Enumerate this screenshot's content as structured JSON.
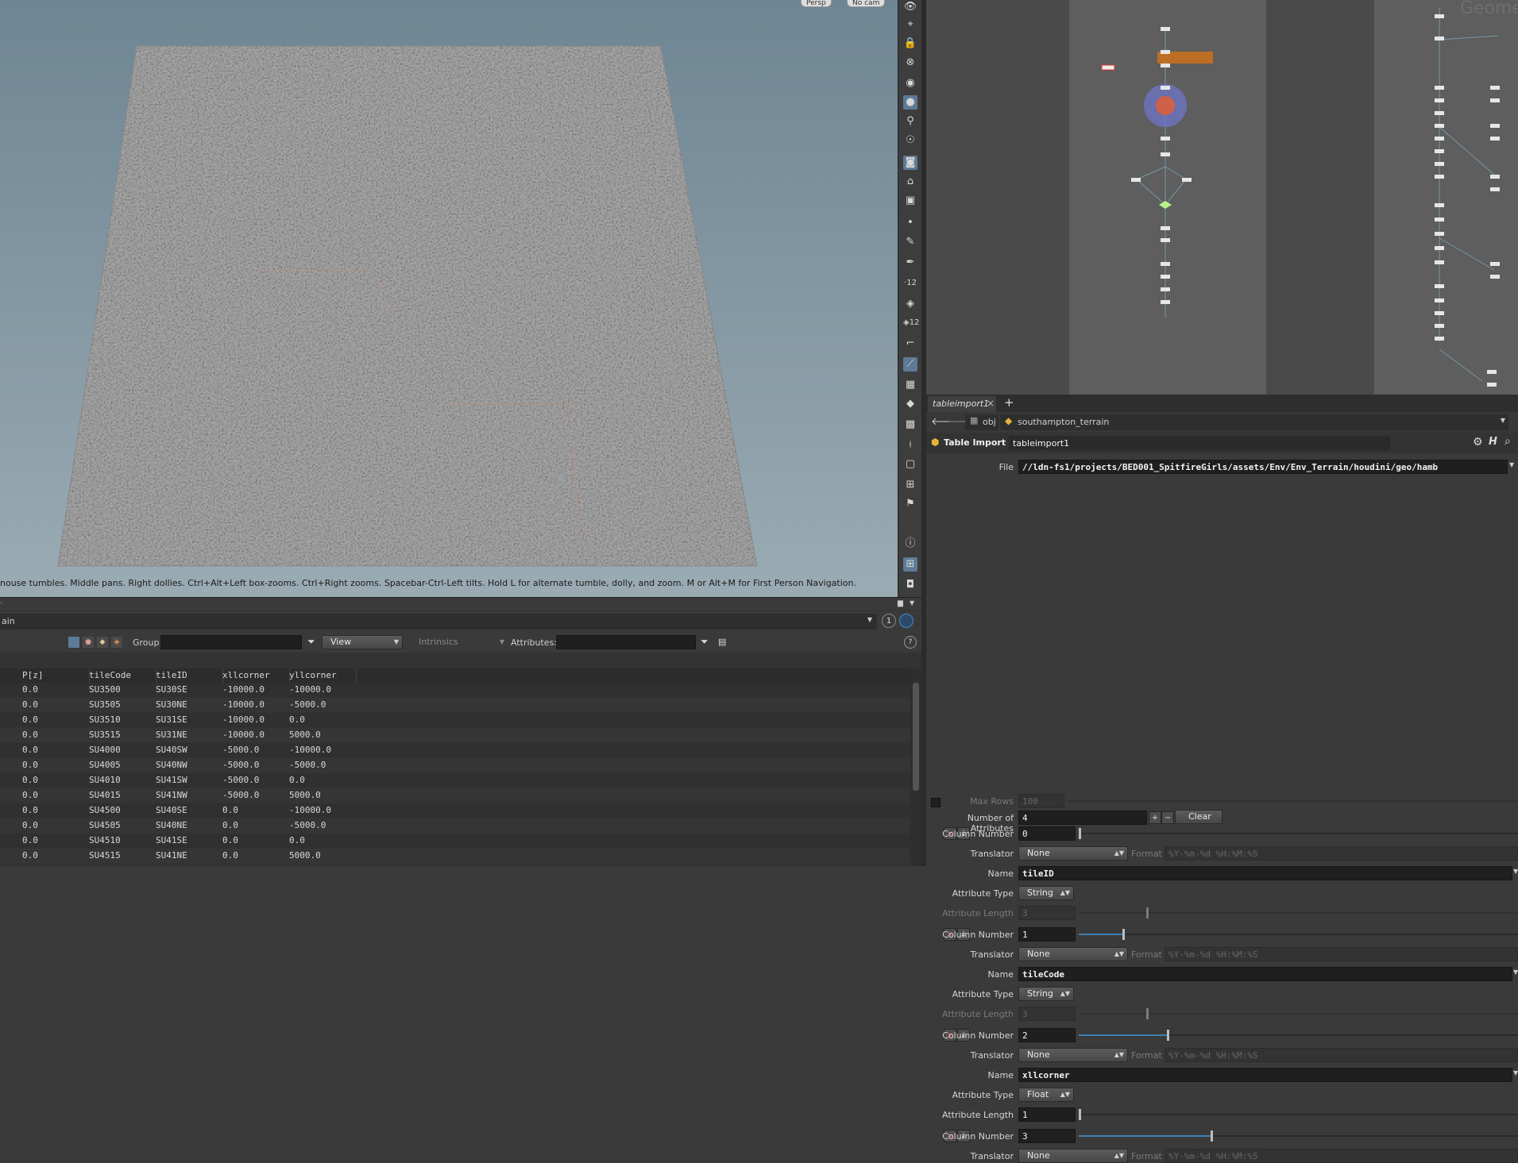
{
  "viewport": {
    "hint": "nouse tumbles. Middle pans. Right dollies. Ctrl+Alt+Left box-zooms. Ctrl+Right zooms. Spacebar-Ctrl-Left tilts. Hold L for alternate tumble, dolly, and zoom.     M or Alt+M for First Person Navigation.",
    "top_buttons": [
      "Persp",
      "No cam"
    ]
  },
  "network": {
    "watermark": "Geome"
  },
  "params": {
    "tab_label": "tableimport1",
    "path": {
      "root": "obj",
      "node": "southampton_terrain"
    },
    "node_type": "Table Import",
    "node_name": "tableimport1",
    "file_label": "File",
    "file_value": "//ldn-fs1/projects/BED001_SpitfireGirls/assets/Env/Env_Terrain/houdini/geo/hamb",
    "max_rows_label": "Max Rows",
    "max_rows_value": "100",
    "num_attr_label": "Number of Attributes",
    "num_attr_value": "4",
    "clear_label": "Clear",
    "labels": {
      "column": "Column Number",
      "translator": "Translator",
      "format": "Format",
      "name": "Name",
      "type": "Attribute Type",
      "length": "Attribute Length"
    },
    "format_placeholder": "%Y-%m-%d %H:%M:%S",
    "attributes": [
      {
        "column": "0",
        "translator": "None",
        "name": "tileID",
        "type": "String",
        "length": "3",
        "length_enabled": false,
        "slider": 0.0
      },
      {
        "column": "1",
        "translator": "None",
        "name": "tileCode",
        "type": "String",
        "length": "3",
        "length_enabled": false,
        "slider": 0.1
      },
      {
        "column": "2",
        "translator": "None",
        "name": "xllcorner",
        "type": "Float",
        "length": "1",
        "length_enabled": true,
        "slider": 0.2
      },
      {
        "column": "3",
        "translator": "None",
        "slider": 0.3
      }
    ]
  },
  "sheet": {
    "path": "ain",
    "group_label": "Group:",
    "view_label": "View",
    "intrinsics_label": "Intrinsics",
    "attributes_label": "Attributes:",
    "columns": [
      "P[z]",
      "tileCode",
      "tileID",
      "xllcorner",
      "yllcorner"
    ],
    "rows": [
      [
        "0.0",
        "SU3500",
        "SU30SE",
        "-10000.0",
        "-10000.0"
      ],
      [
        "0.0",
        "SU3505",
        "SU30NE",
        "-10000.0",
        "-5000.0"
      ],
      [
        "0.0",
        "SU3510",
        "SU31SE",
        "-10000.0",
        "0.0"
      ],
      [
        "0.0",
        "SU3515",
        "SU31NE",
        "-10000.0",
        "5000.0"
      ],
      [
        "0.0",
        "SU4000",
        "SU40SW",
        "-5000.0",
        "-10000.0"
      ],
      [
        "0.0",
        "SU4005",
        "SU40NW",
        "-5000.0",
        "-5000.0"
      ],
      [
        "0.0",
        "SU4010",
        "SU41SW",
        "-5000.0",
        "0.0"
      ],
      [
        "0.0",
        "SU4015",
        "SU41NW",
        "-5000.0",
        "5000.0"
      ],
      [
        "0.0",
        "SU4500",
        "SU40SE",
        "0.0",
        "-10000.0"
      ],
      [
        "0.0",
        "SU4505",
        "SU40NE",
        "0.0",
        "-5000.0"
      ],
      [
        "0.0",
        "SU4510",
        "SU41SE",
        "0.0",
        "0.0"
      ],
      [
        "0.0",
        "SU4515",
        "SU41NE",
        "0.0",
        "5000.0"
      ]
    ]
  }
}
